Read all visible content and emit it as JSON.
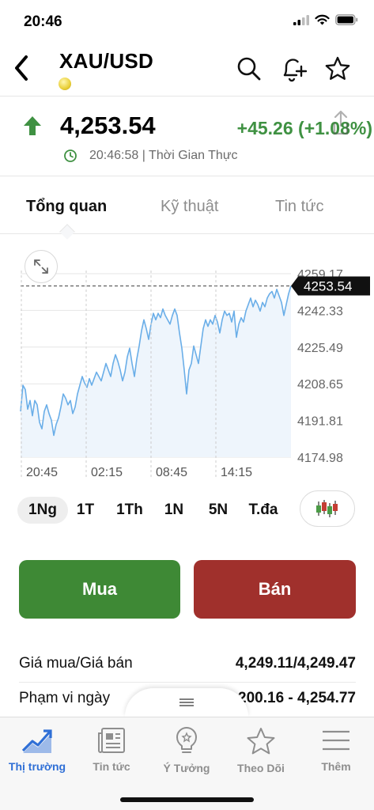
{
  "status_bar": {
    "time": "20:46"
  },
  "header": {
    "title": "XAU/USD"
  },
  "quote": {
    "price": "4,253.54",
    "change": "+45.26 (+1.08%)",
    "time": "20:46:58 | Thời Gian Thực",
    "direction": "up"
  },
  "tabs": [
    {
      "label": "Tổng quan",
      "active": true
    },
    {
      "label": "Kỹ thuật",
      "active": false
    },
    {
      "label": "Tin tức",
      "active": false
    }
  ],
  "chart_data": {
    "type": "area",
    "x_ticks": [
      "20:45",
      "02:15",
      "08:45",
      "14:15"
    ],
    "y_ticks": [
      "4259.17",
      "4242.33",
      "4225.49",
      "4208.65",
      "4191.81",
      "4174.98"
    ],
    "ylim": [
      4174.98,
      4259.17
    ],
    "current_label": "4253.54",
    "current_value": 4253.54,
    "values": [
      4196,
      4208,
      4206,
      4197,
      4201,
      4194,
      4201,
      4199,
      4191,
      4188,
      4196,
      4199,
      4195,
      4192,
      4185,
      4190,
      4193,
      4198,
      4204,
      4202,
      4199,
      4201,
      4195,
      4198,
      4204,
      4208,
      4212,
      4209,
      4207,
      4211,
      4208,
      4211,
      4214,
      4212,
      4210,
      4214,
      4218,
      4215,
      4212,
      4218,
      4222,
      4219,
      4215,
      4210,
      4214,
      4221,
      4225,
      4218,
      4212,
      4220,
      4226,
      4233,
      4238,
      4234,
      4229,
      4236,
      4241,
      4238,
      4241,
      4239,
      4243,
      4240,
      4238,
      4236,
      4240,
      4243,
      4240,
      4232,
      4225,
      4215,
      4204,
      4215,
      4218,
      4226,
      4222,
      4218,
      4226,
      4234,
      4238,
      4235,
      4238,
      4236,
      4240,
      4237,
      4232,
      4238,
      4242,
      4240,
      4241,
      4237,
      4242,
      4230,
      4236,
      4239,
      4237,
      4242,
      4245,
      4248,
      4244,
      4247,
      4245,
      4242,
      4246,
      4244,
      4248,
      4250,
      4251,
      4248,
      4252,
      4249,
      4246,
      4240,
      4245,
      4250,
      4253.54
    ],
    "colors": {
      "line": "#6aaee8",
      "fill": "#eef5fc",
      "label_bg": "#111111"
    }
  },
  "ranges": [
    {
      "label": "1Ng",
      "active": true
    },
    {
      "label": "1T",
      "active": false
    },
    {
      "label": "1Th",
      "active": false
    },
    {
      "label": "1N",
      "active": false
    },
    {
      "label": "5N",
      "active": false
    },
    {
      "label": "T.đa",
      "active": false
    }
  ],
  "actions": {
    "buy": "Mua",
    "sell": "Bán"
  },
  "info": [
    {
      "label": "Giá mua/Giá bán",
      "value": "4,249.11/4,249.47"
    },
    {
      "label": "Phạm vi ngày",
      "value": "4,200.16 - 4,254.77"
    }
  ],
  "tabbar": [
    {
      "label": "Thị trường",
      "icon": "chart-icon",
      "active": true
    },
    {
      "label": "Tin tức",
      "icon": "newspaper-icon",
      "active": false
    },
    {
      "label": "Ý Tưởng",
      "icon": "lightbulb-icon",
      "active": false
    },
    {
      "label": "Theo Dõi",
      "icon": "star-icon",
      "active": false
    },
    {
      "label": "Thêm",
      "icon": "menu-icon",
      "active": false
    }
  ],
  "colors": {
    "up": "#3f9142",
    "buy": "#3e8935",
    "sell": "#a0302c",
    "accent": "#2f6fd6"
  }
}
